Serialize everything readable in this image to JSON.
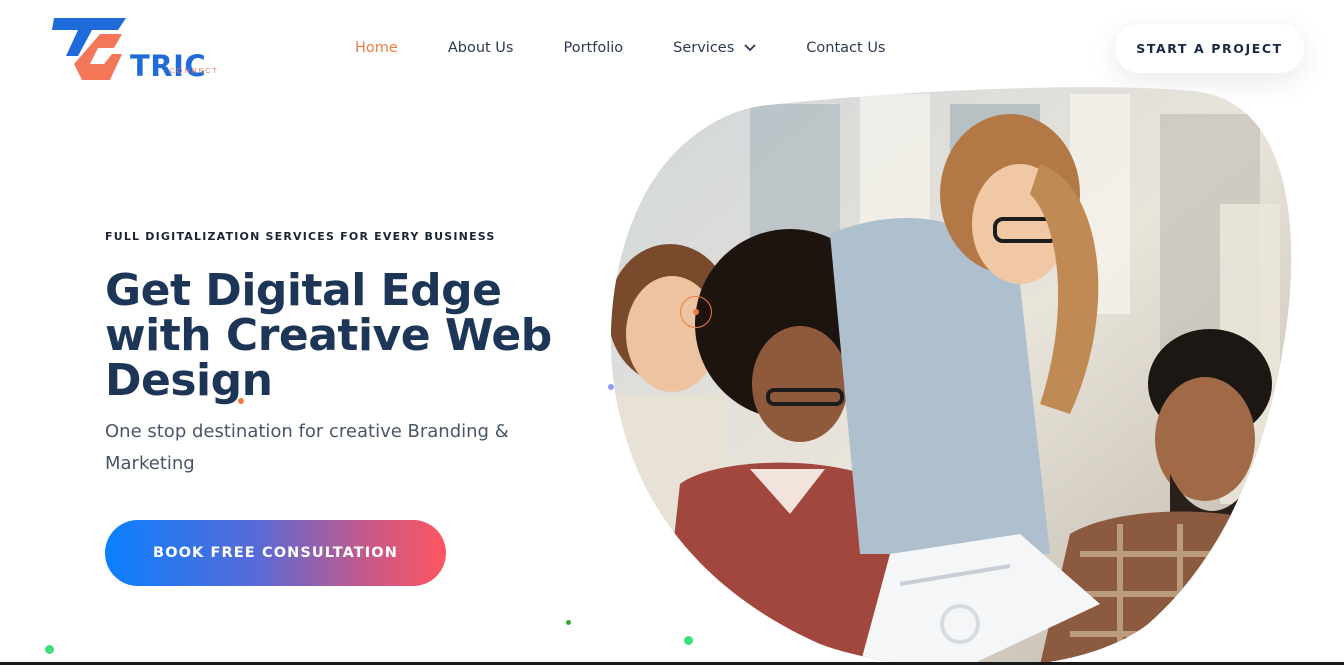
{
  "logo": {
    "wordmark": "TRIC",
    "subtext": "CONNECT"
  },
  "nav": {
    "items": [
      {
        "label": "Home",
        "active": true
      },
      {
        "label": "About Us",
        "active": false
      },
      {
        "label": "Portfolio",
        "active": false
      },
      {
        "label": "Services",
        "active": false,
        "has_dropdown": true
      },
      {
        "label": "Contact Us",
        "active": false
      }
    ],
    "active_color": "#f07b41"
  },
  "header_cta": {
    "label": "START A PROJECT"
  },
  "hero": {
    "eyebrow": "FULL DIGITALIZATION SERVICES FOR EVERY BUSINESS",
    "headline": "Get Digital Edge with Creative Web Design",
    "subtitle": "One stop destination for creative Branding & Marketing",
    "button_label": "BOOK FREE CONSULTATION",
    "button_gradient": [
      "#0a80ff",
      "#ff5560"
    ],
    "image_alt": "Team of four people smiling and reviewing documents together"
  },
  "colors": {
    "primary_navy": "#1d3557",
    "accent_orange": "#f07b41",
    "logo_blue": "#1f6bd9",
    "logo_coral": "#f4775a"
  }
}
